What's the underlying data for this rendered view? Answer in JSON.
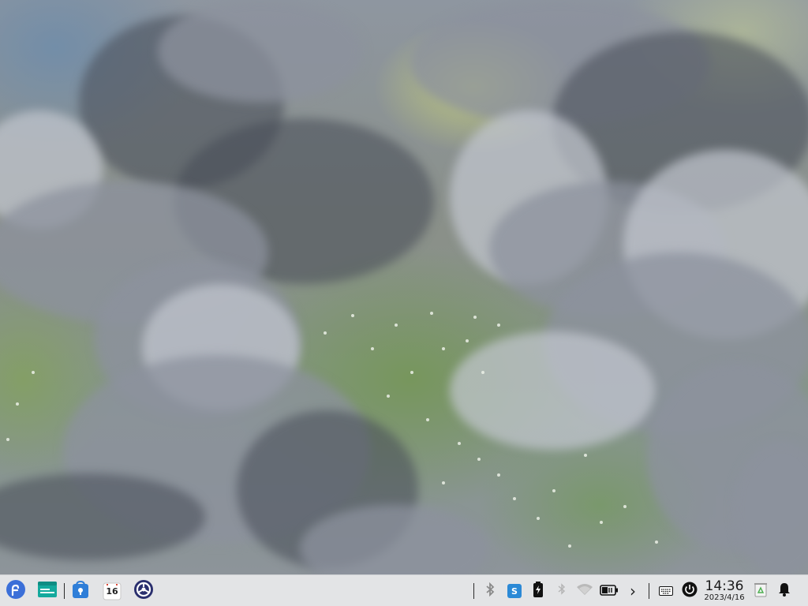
{
  "desktop": {
    "wallpaper": "watercolor-clouds-over-meadow"
  },
  "taskbar": {
    "background": "#e3e4e6",
    "launcher_icon": "start-menu-icon",
    "pinned": [
      {
        "name": "file-manager-icon"
      },
      {
        "name": "app-store-icon"
      },
      {
        "name": "calendar-icon",
        "badge": "16"
      },
      {
        "name": "settings-icon"
      }
    ],
    "tray": [
      {
        "name": "bluetooth-icon"
      },
      {
        "name": "input-method-icon",
        "label": "S"
      },
      {
        "name": "battery-charging-icon"
      },
      {
        "name": "bluetooth-disabled-icon"
      },
      {
        "name": "wifi-icon"
      },
      {
        "name": "battery-indicator-icon"
      },
      {
        "name": "chevron-right-icon",
        "label": "›"
      },
      {
        "name": "keyboard-icon"
      },
      {
        "name": "power-icon"
      },
      {
        "name": "recycle-bin-icon"
      },
      {
        "name": "notification-bell-icon"
      }
    ],
    "clock": {
      "time": "14:36",
      "date": "2023/4/16"
    }
  }
}
